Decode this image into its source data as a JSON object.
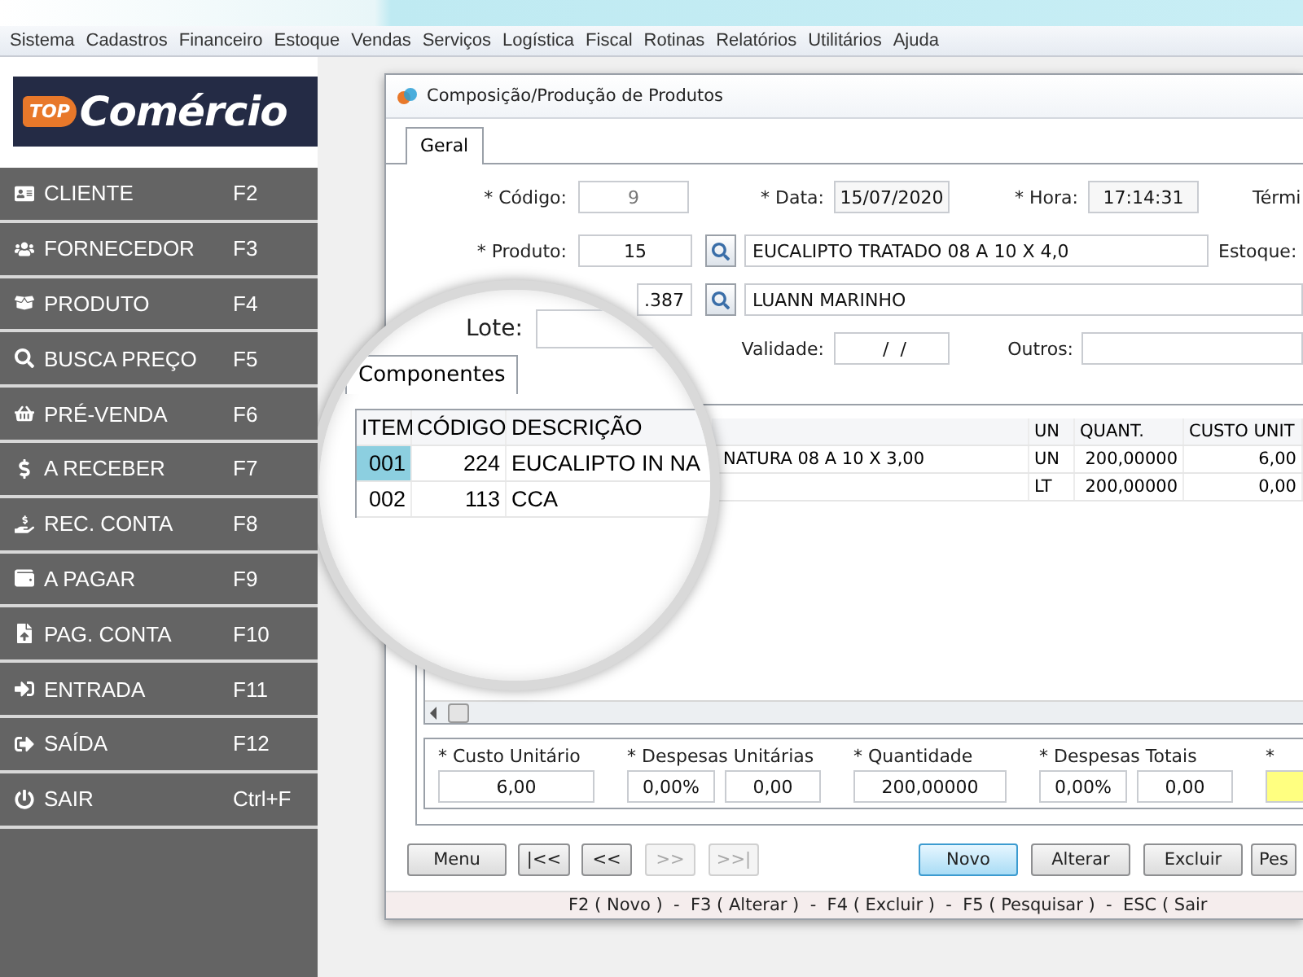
{
  "menu_bar": [
    "Sistema",
    "Cadastros",
    "Financeiro",
    "Estoque",
    "Vendas",
    "Serviços",
    "Logística",
    "Fiscal",
    "Rotinas",
    "Relatórios",
    "Utilitários",
    "Ajuda"
  ],
  "logo": {
    "badge": "TOP",
    "name": "Comércio"
  },
  "sidebar": {
    "items": [
      {
        "label": "CLIENTE",
        "shortcut": "F2"
      },
      {
        "label": "FORNECEDOR",
        "shortcut": "F3"
      },
      {
        "label": "PRODUTO",
        "shortcut": "F4"
      },
      {
        "label": "BUSCA PREÇO",
        "shortcut": "F5"
      },
      {
        "label": "PRÉ-VENDA",
        "shortcut": "F6"
      },
      {
        "label": "A RECEBER",
        "shortcut": "F7"
      },
      {
        "label": "REC. CONTA",
        "shortcut": "F8"
      },
      {
        "label": "A PAGAR",
        "shortcut": "F9"
      },
      {
        "label": "PAG. CONTA",
        "shortcut": "F10"
      },
      {
        "label": "ENTRADA",
        "shortcut": "F11"
      },
      {
        "label": "SAÍDA",
        "shortcut": "F12"
      },
      {
        "label": "SAIR",
        "shortcut": "Ctrl+F"
      }
    ]
  },
  "window": {
    "title": "Composição/Produção de Produtos",
    "tabs": [
      {
        "label": "Geral",
        "selected": true
      }
    ],
    "form": {
      "codigo_label": "* Código:",
      "codigo": "9",
      "data_label": "* Data:",
      "data": "15/07/2020",
      "hora_label": "* Hora:",
      "hora": "17:14:31",
      "termino_label": "Térmi",
      "produto_label": "* Produto:",
      "produto": "15",
      "produto_descricao": "EUCALIPTO TRATADO 08 A 10 X 4,0",
      "estoque_label": "Estoque:",
      "field_3": ".387",
      "field_3_descricao": "LUANN MARINHO",
      "validade_label": "Validade:",
      "validade": " /  /",
      "outros_label": "Outros:"
    },
    "grid": {
      "columns": [
        "UN",
        "QUANT.",
        "CUSTO UNIT"
      ],
      "rows": [
        {
          "descricao": "NATURA 08 A 10 X 3,00",
          "un": "UN",
          "quant": "200,00000",
          "custo": "6,00"
        },
        {
          "descricao": "",
          "un": "LT",
          "quant": "200,00000",
          "custo": "0,00"
        }
      ]
    },
    "totals": [
      {
        "label": "* Custo Unitário",
        "fields": [
          {
            "value": "6,00",
            "highlighted": false
          }
        ]
      },
      {
        "label": "* Despesas Unitárias",
        "fields": [
          {
            "value": "0,00%",
            "highlighted": false
          },
          {
            "value": "0,00",
            "highlighted": false
          }
        ]
      },
      {
        "label": "* Quantidade",
        "fields": [
          {
            "value": "200,00000",
            "highlighted": false
          }
        ]
      },
      {
        "label": "* Despesas Totais",
        "fields": [
          {
            "value": "0,00%",
            "highlighted": false
          },
          {
            "value": "0,00",
            "highlighted": false
          }
        ]
      },
      {
        "label": "*",
        "fields": [
          {
            "highlighted": true
          }
        ]
      }
    ],
    "buttons": [
      {
        "label": "Menu",
        "disabled": false,
        "focused": false
      },
      {
        "label": "|<<",
        "disabled": false,
        "focused": false
      },
      {
        "label": "<<",
        "disabled": false,
        "focused": false
      },
      {
        "label": ">>",
        "disabled": true,
        "focused": false
      },
      {
        "label": ">>|",
        "disabled": true,
        "focused": false
      },
      {
        "label": "Novo",
        "disabled": false,
        "focused": true
      },
      {
        "label": "Alterar",
        "disabled": false,
        "focused": false
      },
      {
        "label": "Excluir",
        "disabled": false,
        "focused": false
      },
      {
        "label": "Pes",
        "disabled": false,
        "focused": false
      }
    ],
    "status": "F2 ( Novo )  -  F3 ( Alterar )  -  F4 ( Excluir )  -  F5 ( Pesquisar )  -  ESC ( Sair"
  },
  "magnifier": {
    "lote_label": "Lote:",
    "tab": {
      "label": "Componentes",
      "selected": true
    },
    "columns": [
      "ITEM",
      "CÓDIGO",
      "DESCRIÇÃO"
    ],
    "rows": [
      {
        "item": "001",
        "codigo": "224",
        "descricao": "EUCALIPTO IN NA",
        "selected": true
      },
      {
        "item": "002",
        "codigo": "113",
        "descricao": "CCA",
        "selected": false
      }
    ]
  }
}
